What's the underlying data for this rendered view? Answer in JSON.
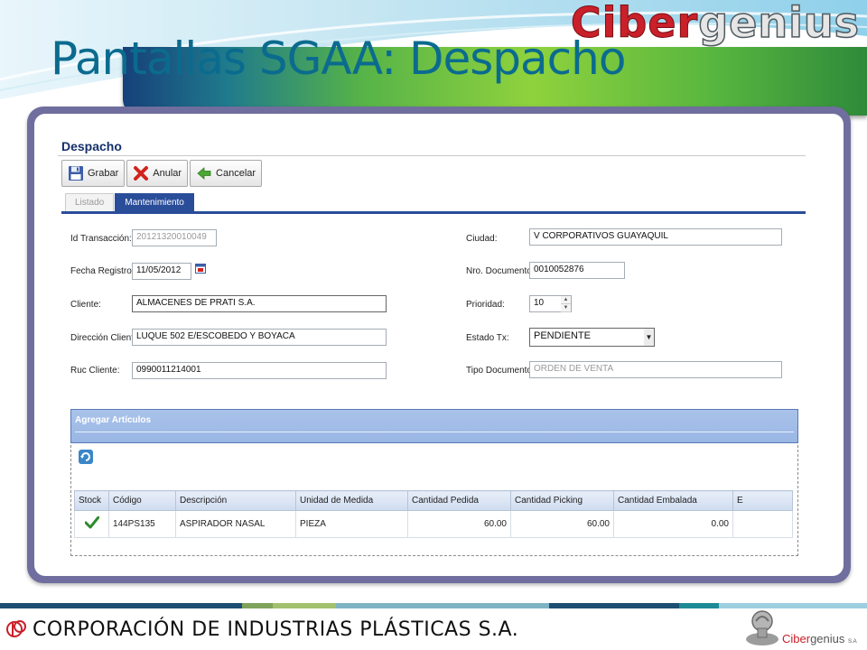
{
  "slide": {
    "title": "Pantallas SGAA: Despacho",
    "brand_a": "Ciber",
    "brand_b": "genius",
    "footer_company": "CORPORACIÓN DE INDUSTRIAS PLÁSTICAS S.A.",
    "footer_brand_a": "Ciber",
    "footer_brand_b": "genius",
    "footer_brand_suffix": "S.A"
  },
  "app": {
    "title": "Despacho",
    "toolbar": {
      "save_label": "Grabar",
      "void_label": "Anular",
      "cancel_label": "Cancelar"
    },
    "tabs": [
      {
        "label": "Listado"
      },
      {
        "label": "Mantenimiento"
      }
    ],
    "form": {
      "id_transaccion": {
        "label": "Id Transacción:",
        "value": "20121320010049"
      },
      "fecha_registro": {
        "label": "Fecha Registro:",
        "value": "11/05/2012"
      },
      "cliente": {
        "label": "Cliente:",
        "value": "ALMACENES DE PRATI  S.A."
      },
      "direccion_cliente": {
        "label": "Dirección Cliente:",
        "value": "LUQUE 502 E/ESCOBEDO Y BOYACA"
      },
      "ruc_cliente": {
        "label": "Ruc Cliente:",
        "value": "0990011214001"
      },
      "ciudad": {
        "label": "Ciudad:",
        "value": "V CORPORATIVOS GUAYAQUIL"
      },
      "nro_documento": {
        "label": "Nro. Documento:",
        "value": "0010052876"
      },
      "prioridad": {
        "label": "Prioridad:",
        "value": "10"
      },
      "estado_tx": {
        "label": "Estado Tx:",
        "value": "PENDIENTE"
      },
      "tipo_documento": {
        "label": "Tipo Documento:",
        "value": "ORDEN DE VENTA"
      }
    },
    "articles": {
      "header": "Agregar Artículos",
      "columns": [
        "Stock",
        "Código",
        "Descripción",
        "Unidad de Medida",
        "Cantidad Pedida",
        "Cantidad Picking",
        "Cantidad Embalada",
        "E"
      ],
      "rows": [
        {
          "stock_icon": "check-icon",
          "codigo": "144PS135",
          "descripcion": "ASPIRADOR NASAL",
          "unidad": "PIEZA",
          "pedida": "60.00",
          "picking": "60.00",
          "embalada": "0.00",
          "e": ""
        }
      ]
    }
  },
  "colors": {
    "title": "#0b6b8e",
    "tab_active": "#2a4d9a",
    "frame": "#6f6e9e",
    "brand_red": "#c9202a",
    "stock_ok": "#2e8b2e"
  }
}
